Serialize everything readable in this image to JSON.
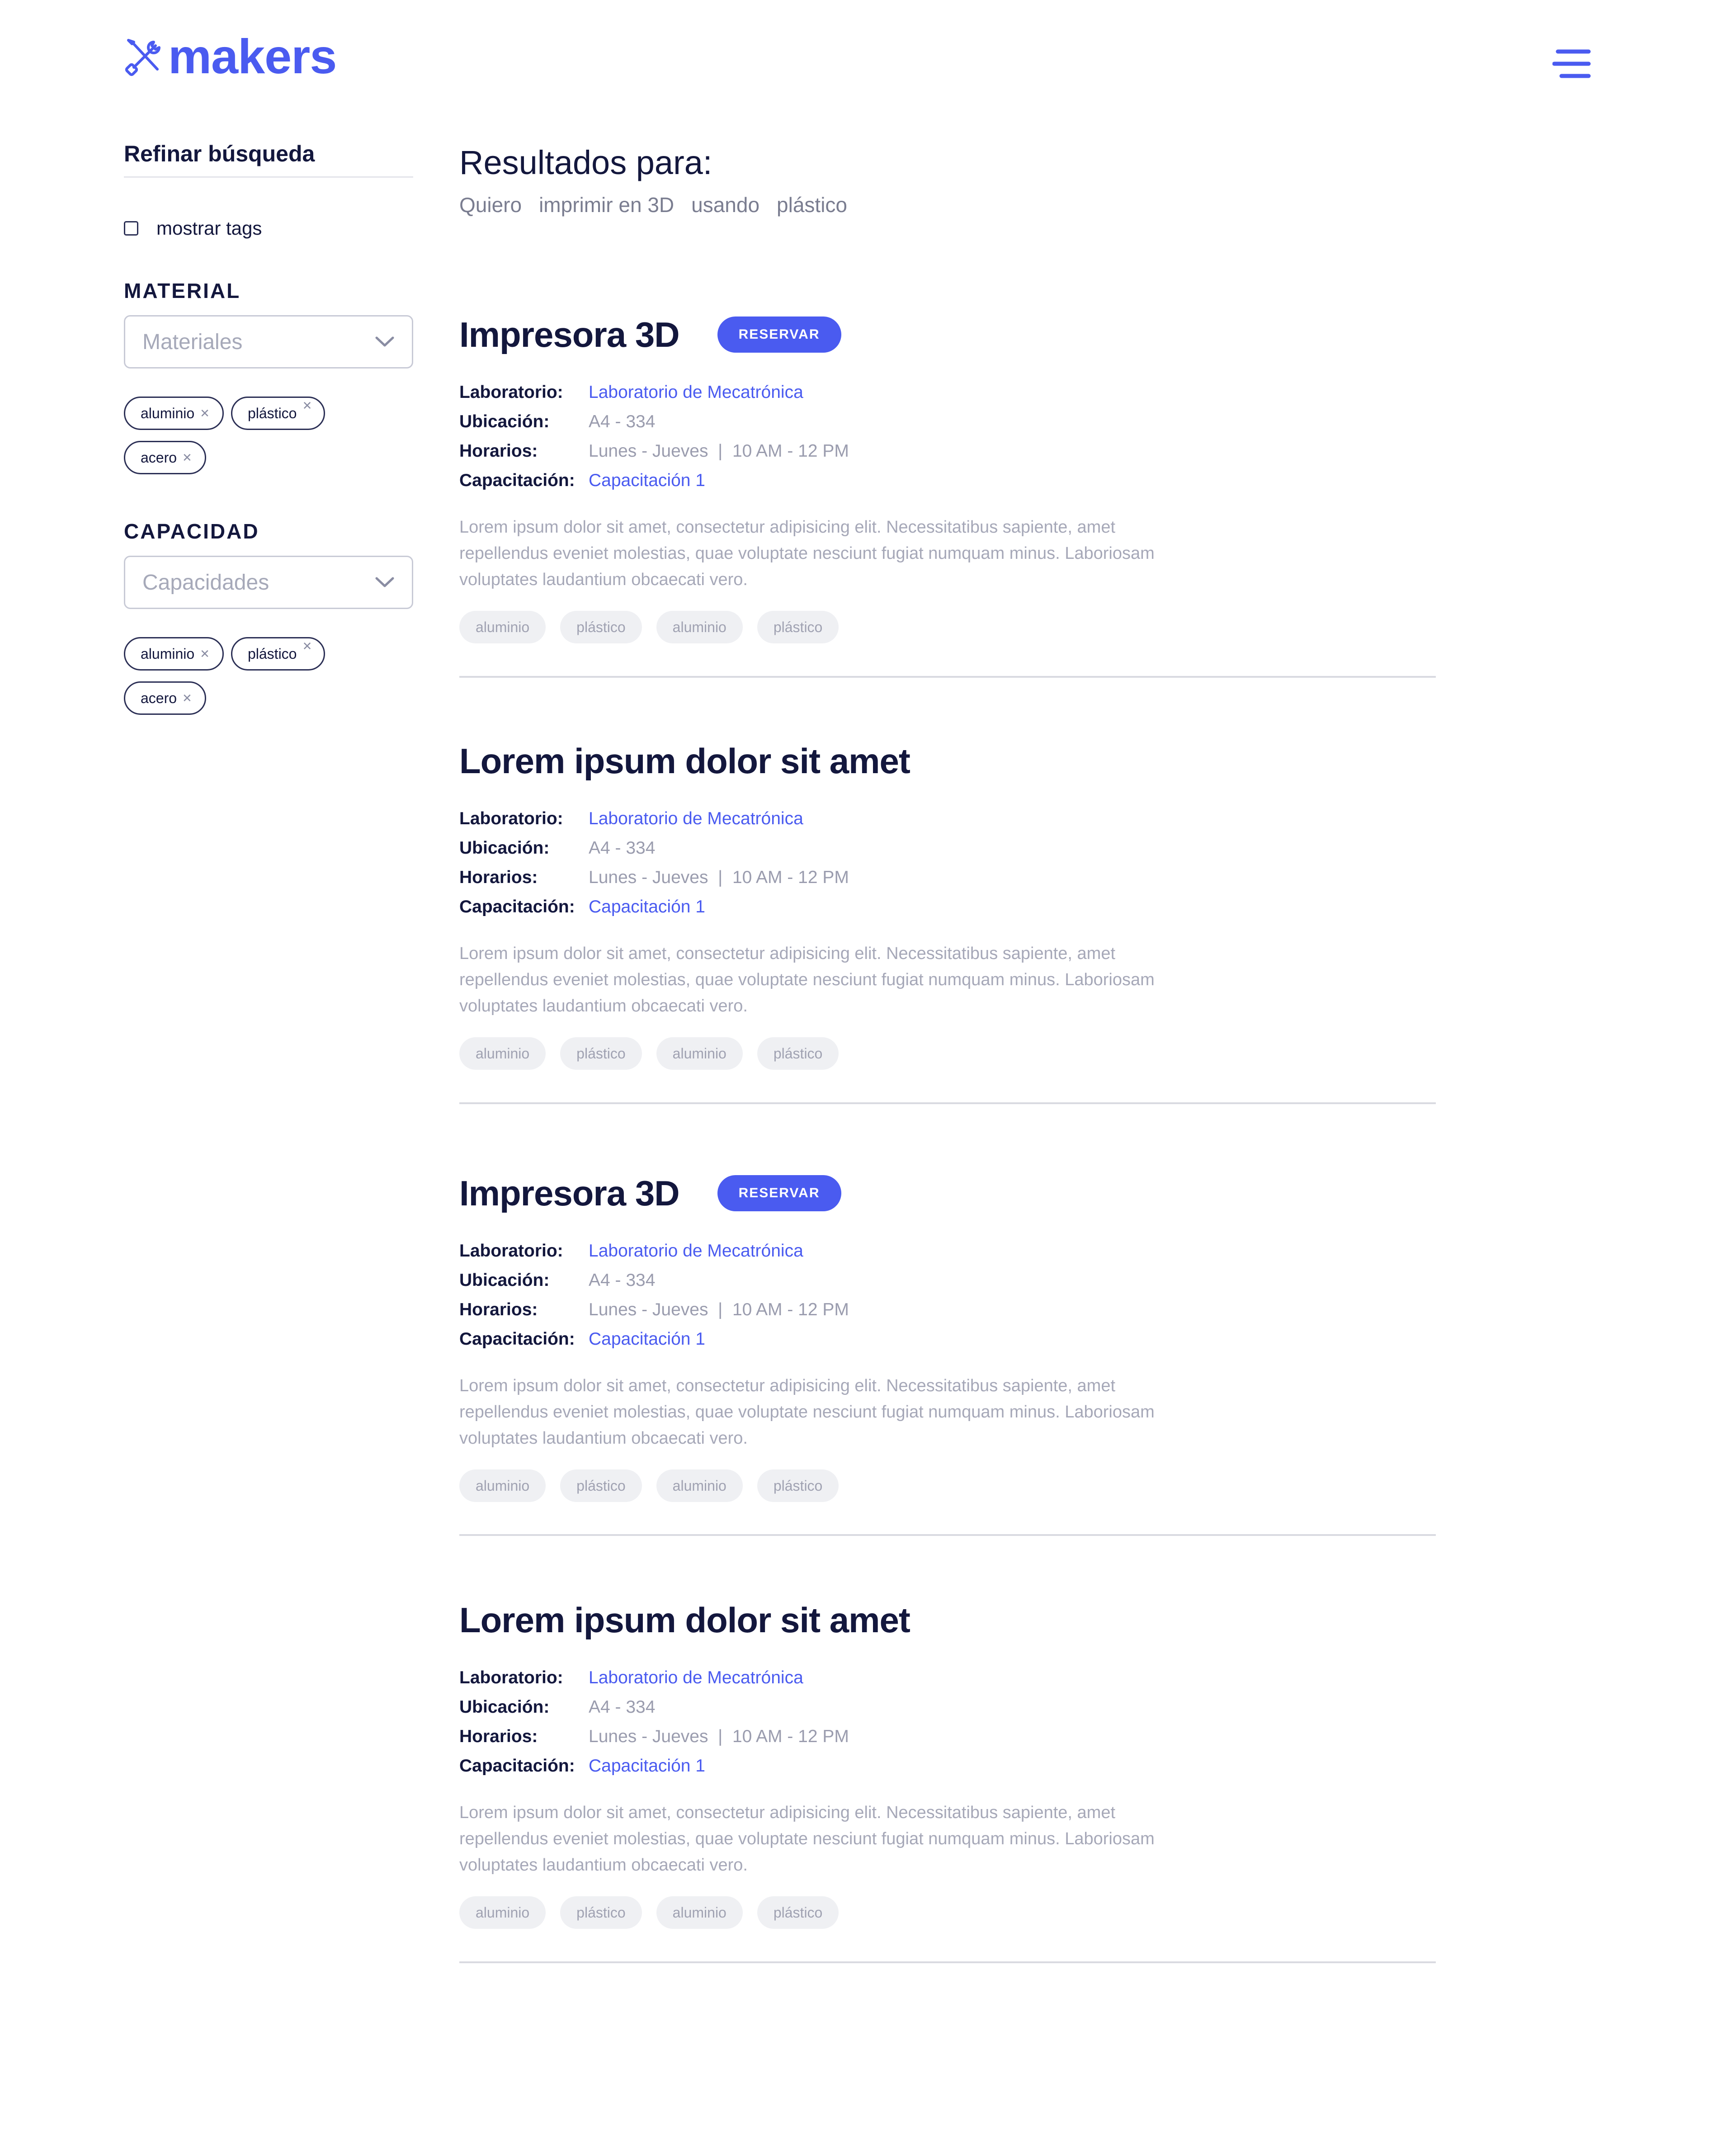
{
  "brand": {
    "name": "makers",
    "accent": "#4a5bf0",
    "logo_icon": "tools-icon"
  },
  "header": {
    "menu_icon": "menu-icon"
  },
  "sidebar": {
    "title": "Refinar búsqueda",
    "show_tags": {
      "label": "mostrar tags",
      "checked": false
    },
    "material": {
      "label": "MATERIAL",
      "placeholder": "Materiales",
      "chips": [
        "aluminio",
        "plástico",
        "acero"
      ]
    },
    "capacity": {
      "label": "CAPACIDAD",
      "placeholder": "Capacidades",
      "chips": [
        "aluminio",
        "plástico",
        "acero"
      ]
    }
  },
  "main": {
    "results_title": "Resultados para:",
    "query": [
      "Quiero",
      "imprimir en 3D",
      "usando",
      "plástico"
    ],
    "results": [
      {
        "title": "Impresora 3D",
        "reserve_label": "RESERVAR",
        "labels": {
          "lab": "Laboratorio:",
          "loc": "Ubicación:",
          "hours": "Horarios:",
          "training": "Capacitación:"
        },
        "lab": "Laboratorio de Mecatrónica",
        "location": "A4 - 334",
        "hours": "Lunes - Jueves  |  10 AM - 12 PM",
        "training": "Capacitación 1",
        "description": "Lorem ipsum dolor sit amet, consectetur adipisicing elit. Necessitatibus sapiente, amet repellendus eveniet molestias, quae voluptate nesciunt fugiat numquam minus. Laboriosam voluptates laudantium obcaecati vero.",
        "tags": [
          "aluminio",
          "plástico",
          "aluminio",
          "plástico"
        ]
      },
      {
        "title": "Lorem ipsum dolor sit amet",
        "reserve_label": "",
        "labels": {
          "lab": "Laboratorio:",
          "loc": "Ubicación:",
          "hours": "Horarios:",
          "training": "Capacitación:"
        },
        "lab": "Laboratorio de Mecatrónica",
        "location": "A4 - 334",
        "hours": "Lunes - Jueves  |  10 AM - 12 PM",
        "training": "Capacitación 1",
        "description": "Lorem ipsum dolor sit amet, consectetur adipisicing elit. Necessitatibus sapiente, amet repellendus eveniet molestias, quae voluptate nesciunt fugiat numquam minus. Laboriosam voluptates laudantium obcaecati vero.",
        "tags": [
          "aluminio",
          "plástico",
          "aluminio",
          "plástico"
        ]
      },
      {
        "title": "Impresora 3D",
        "reserve_label": "RESERVAR",
        "labels": {
          "lab": "Laboratorio:",
          "loc": "Ubicación:",
          "hours": "Horarios:",
          "training": "Capacitación:"
        },
        "lab": "Laboratorio de Mecatrónica",
        "location": "A4 - 334",
        "hours": "Lunes - Jueves  |  10 AM - 12 PM",
        "training": "Capacitación 1",
        "description": "Lorem ipsum dolor sit amet, consectetur adipisicing elit. Necessitatibus sapiente, amet repellendus eveniet molestias, quae voluptate nesciunt fugiat numquam minus. Laboriosam voluptates laudantium obcaecati vero.",
        "tags": [
          "aluminio",
          "plástico",
          "aluminio",
          "plástico"
        ]
      },
      {
        "title": "Lorem ipsum dolor sit amet",
        "reserve_label": "",
        "labels": {
          "lab": "Laboratorio:",
          "loc": "Ubicación:",
          "hours": "Horarios:",
          "training": "Capacitación:"
        },
        "lab": "Laboratorio de Mecatrónica",
        "location": "A4 - 334",
        "hours": "Lunes - Jueves  |  10 AM - 12 PM",
        "training": "Capacitación 1",
        "description": "Lorem ipsum dolor sit amet, consectetur adipisicing elit. Necessitatibus sapiente, amet repellendus eveniet molestias, quae voluptate nesciunt fugiat numquam minus. Laboriosam voluptates laudantium obcaecati vero.",
        "tags": [
          "aluminio",
          "plástico",
          "aluminio",
          "plástico"
        ]
      }
    ]
  }
}
